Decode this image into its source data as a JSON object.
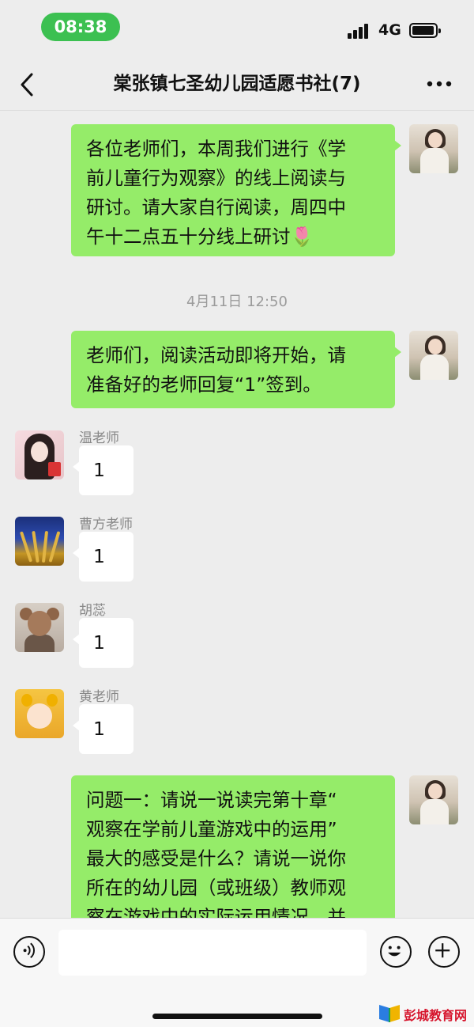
{
  "status_bar": {
    "time": "08:38",
    "network": "4G"
  },
  "header": {
    "title": "棠张镇七圣幼儿园适愿书社(7)"
  },
  "messages": [
    {
      "sender": "self",
      "text": "各位老师们，本周我们进行《学\n前儿童行为观察》的线上阅读与\n研讨。请大家自行阅读，周四中\n午十二点五十分线上研讨",
      "emoji": "🌷"
    },
    {
      "type": "timestamp",
      "text": "4月11日 12:50"
    },
    {
      "sender": "self",
      "text": "老师们，阅读活动即将开始，请\n准备好的老师回复“1”签到。"
    },
    {
      "sender": "温老师",
      "text": "1"
    },
    {
      "sender": "曹方老师",
      "text": "1"
    },
    {
      "sender": "胡蕊",
      "text": "1"
    },
    {
      "sender": "黄老师",
      "text": "1"
    },
    {
      "sender": "self",
      "text": "问题一：请说一说读完第十章“\n观察在学前儿童游戏中的运用”\n最大的感受是什么？请说一说你\n所在的幼儿园（或班级）教师观\n察在游戏中的实际运用情况，并"
    }
  ],
  "input_bar": {
    "placeholder": ""
  },
  "watermark": {
    "text": "彭城教育网"
  },
  "colors": {
    "self_bubble": "#95ec69",
    "other_bubble": "#ffffff",
    "background": "#ededed",
    "time_pill": "#3cc051"
  },
  "icons": [
    "back-arrow-icon",
    "more-dots-icon",
    "voice-icon",
    "emoji-icon",
    "plus-icon",
    "signal-icon",
    "battery-icon"
  ]
}
